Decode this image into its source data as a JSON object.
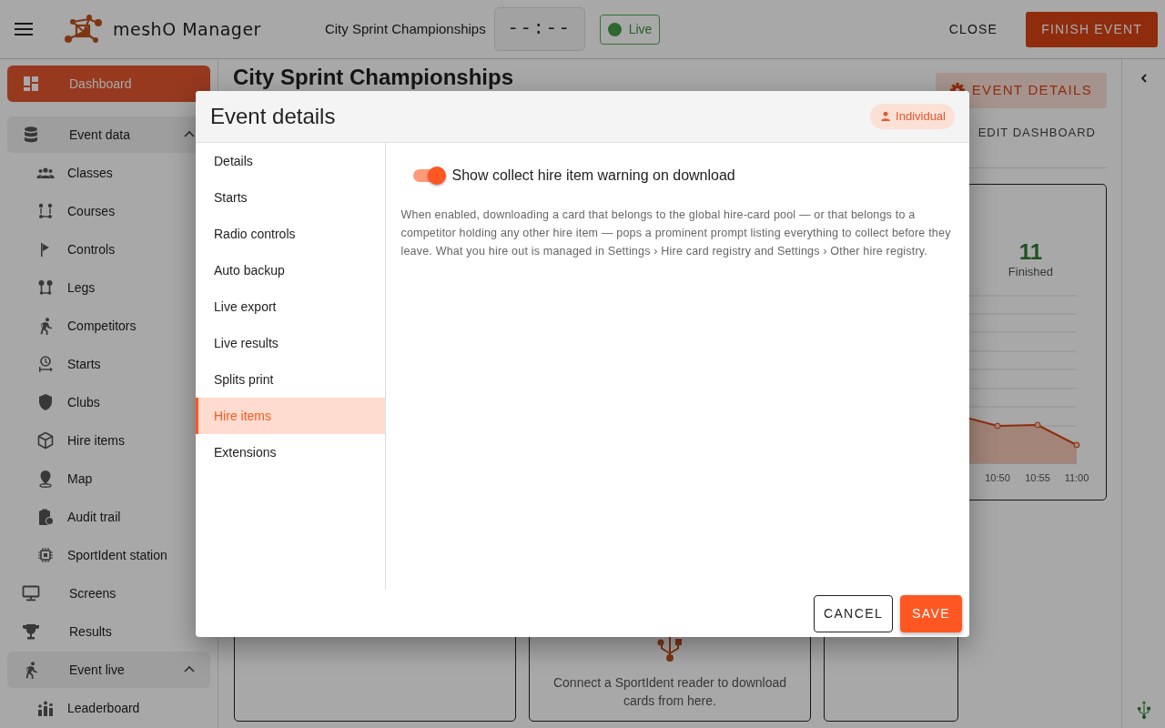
{
  "app": {
    "name": "meshO Manager",
    "event_name": "City Sprint Championships",
    "clock": "--:--",
    "live_label": "Live",
    "close_button": "CLOSE",
    "finish_button": "FINISH EVENT"
  },
  "sidebar": {
    "items": [
      {
        "kind": "item",
        "label": "Dashboard",
        "selected": true
      },
      {
        "kind": "group",
        "label": "Event data",
        "expanded": true,
        "children": [
          {
            "label": "Classes",
            "selected": false
          },
          {
            "label": "Courses",
            "selected": false
          },
          {
            "label": "Controls",
            "selected": false
          },
          {
            "label": "Legs",
            "selected": false
          },
          {
            "label": "Competitors",
            "selected": false
          },
          {
            "label": "Starts",
            "selected": false
          },
          {
            "label": "Clubs",
            "selected": false
          },
          {
            "label": "Hire items",
            "selected": false
          },
          {
            "label": "Map",
            "selected": false
          },
          {
            "label": "Audit trail",
            "selected": false
          },
          {
            "label": "SportIdent station",
            "selected": false
          }
        ]
      },
      {
        "kind": "item",
        "label": "Screens",
        "selected": false
      },
      {
        "kind": "item",
        "label": "Results",
        "selected": false
      },
      {
        "kind": "group",
        "label": "Event live",
        "expanded": true,
        "children": [
          {
            "label": "Leaderboard",
            "selected": false
          }
        ]
      }
    ]
  },
  "main": {
    "title": "City Sprint Championships",
    "event_details_button": "EVENT DETAILS",
    "edit_dashboard_button": "EDIT DASHBOARD",
    "stat": {
      "value": "11",
      "label": "Finished"
    },
    "chart_x_labels": [
      "10:50",
      "10:55",
      "11:00"
    ],
    "reader_hint": "Connect a SportIdent reader to download cards from here."
  },
  "dialog": {
    "title": "Event details",
    "badge": "Individual",
    "nav": [
      {
        "label": "Details",
        "selected": false
      },
      {
        "label": "Starts",
        "selected": false
      },
      {
        "label": "Radio controls",
        "selected": false
      },
      {
        "label": "Auto backup",
        "selected": false
      },
      {
        "label": "Live export",
        "selected": false
      },
      {
        "label": "Live results",
        "selected": false
      },
      {
        "label": "Splits print",
        "selected": false
      },
      {
        "label": "Hire items",
        "selected": true
      },
      {
        "label": "Extensions",
        "selected": false
      }
    ],
    "setting": {
      "label": "Show collect hire item warning on download",
      "on": true,
      "description": "When enabled, downloading a card that belongs to the global hire-card pool — or that belongs to a competitor holding any other hire item — pops a prominent prompt listing everything to collect before they leave. What you hire out is managed in Settings › Hire card registry and Settings › Other hire registry."
    },
    "buttons": [
      {
        "kind": "outline",
        "label": "CANCEL"
      },
      {
        "kind": "primary",
        "label": "SAVE"
      }
    ]
  }
}
